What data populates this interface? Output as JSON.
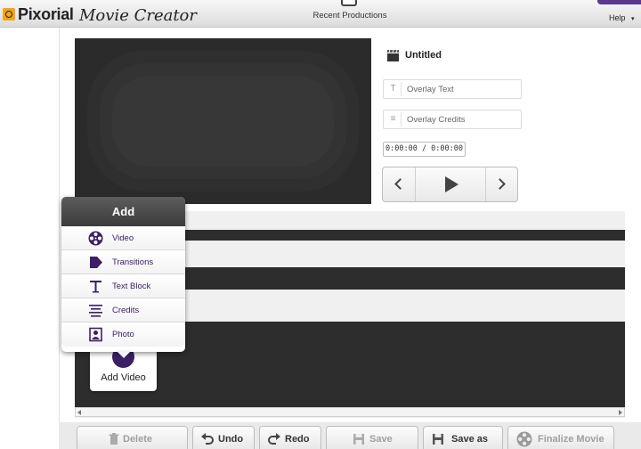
{
  "app": {
    "brand": "Pixorial",
    "product": "Movie Creator",
    "recent_productions": "Recent Productions",
    "help": "Help",
    "help_arrow": "▾",
    "accent_color": "#5a3a8e"
  },
  "movie": {
    "title": "Untitled",
    "overlay_text_placeholder": "Overlay Text",
    "overlay_credits_placeholder": "Overlay Credits",
    "timecode": "0:00:00 / 0:00:00"
  },
  "add_menu": {
    "title": "Add",
    "items": [
      {
        "label": "Video",
        "icon": "film-reel-icon"
      },
      {
        "label": "Transitions",
        "icon": "arrow-right-icon"
      },
      {
        "label": "Text Block",
        "icon": "text-t-icon"
      },
      {
        "label": "Credits",
        "icon": "lines-icon"
      },
      {
        "label": "Photo",
        "icon": "portrait-icon"
      }
    ]
  },
  "add_video": {
    "label": "Add Video"
  },
  "toolbar": {
    "delete": "Delete",
    "undo": "Undo",
    "redo": "Redo",
    "save": "Save",
    "save_as": "Save as",
    "finalize": "Finalize Movie"
  }
}
